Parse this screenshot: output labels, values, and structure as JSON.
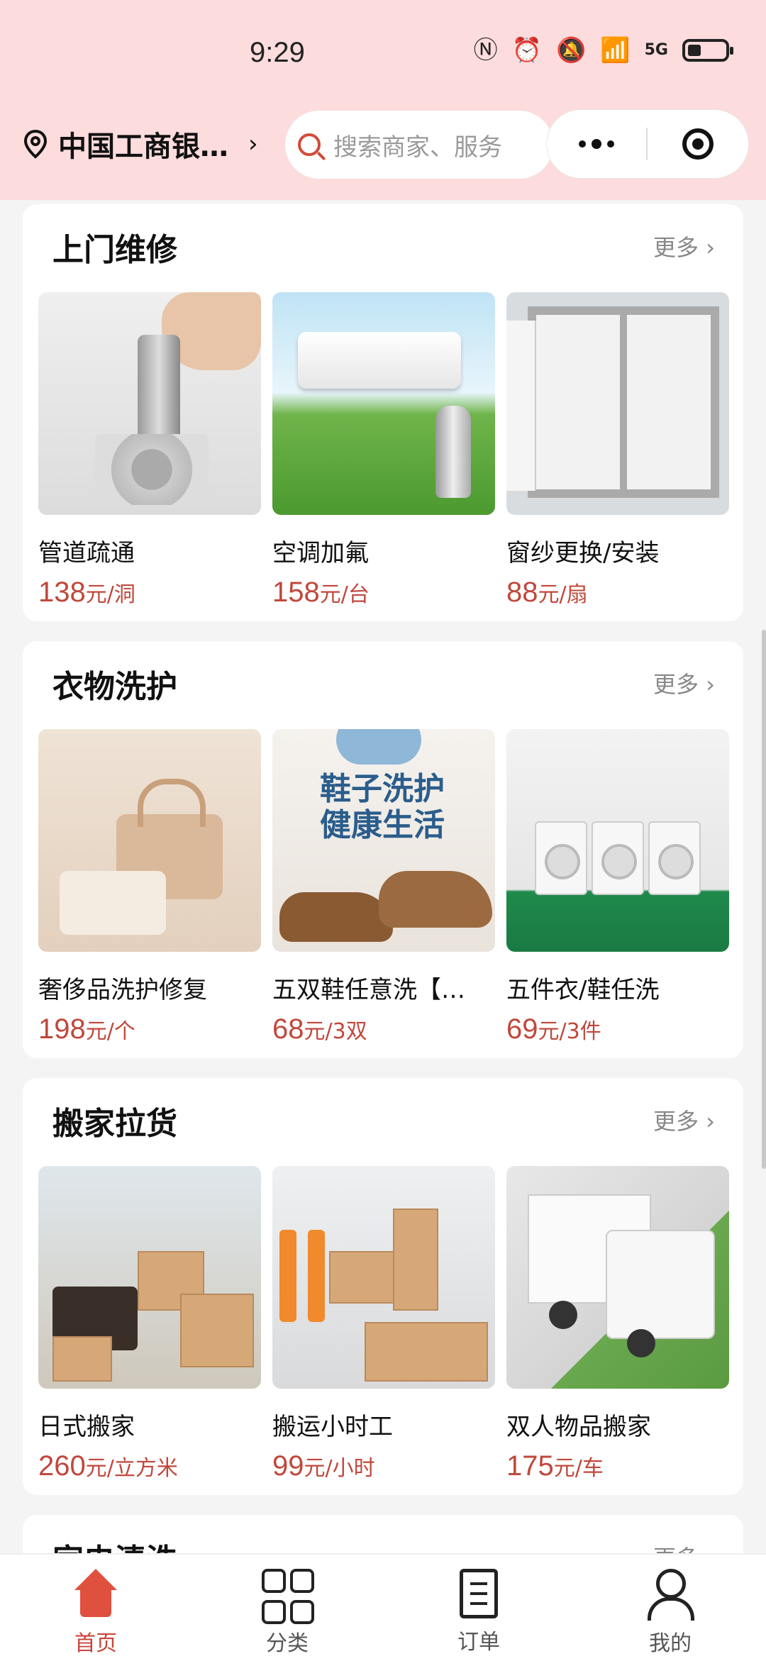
{
  "status": {
    "time": "9:29",
    "network": "5G"
  },
  "header": {
    "location": "中国工商银…",
    "search_placeholder": "搜索商家、服务"
  },
  "sections": [
    {
      "title": "上门维修",
      "more": "更多",
      "items": [
        {
          "name": "管道疏通",
          "price": "138",
          "unit": "元/洞"
        },
        {
          "name": "空调加氟",
          "price": "158",
          "unit": "元/台"
        },
        {
          "name": "窗纱更换/安装",
          "price": "88",
          "unit": "元/扇"
        }
      ]
    },
    {
      "title": "衣物洗护",
      "more": "更多",
      "items": [
        {
          "name": "奢侈品洗护修复",
          "price": "198",
          "unit": "元/个"
        },
        {
          "name": "五双鞋任意洗【…",
          "price": "68",
          "unit": "元/3双"
        },
        {
          "name": "五件衣/鞋任洗",
          "price": "69",
          "unit": "元/3件"
        }
      ],
      "shoe_banner": "鞋子洗护\n健康生活"
    },
    {
      "title": "搬家拉货",
      "more": "更多",
      "items": [
        {
          "name": "日式搬家",
          "price": "260",
          "unit": "元/立方米"
        },
        {
          "name": "搬运小时工",
          "price": "99",
          "unit": "元/小时"
        },
        {
          "name": "双人物品搬家",
          "price": "175",
          "unit": "元/车"
        }
      ]
    },
    {
      "title": "家电清洗",
      "more": "更多"
    }
  ],
  "tabbar": [
    {
      "label": "首页",
      "icon": "home-icon",
      "active": true
    },
    {
      "label": "分类",
      "icon": "grid-icon",
      "active": false
    },
    {
      "label": "订单",
      "icon": "order-icon",
      "active": false
    },
    {
      "label": "我的",
      "icon": "user-icon",
      "active": false
    }
  ],
  "colors": {
    "header_bg": "#fcdcdc",
    "price": "#c0483c",
    "accent": "#e0503f"
  }
}
